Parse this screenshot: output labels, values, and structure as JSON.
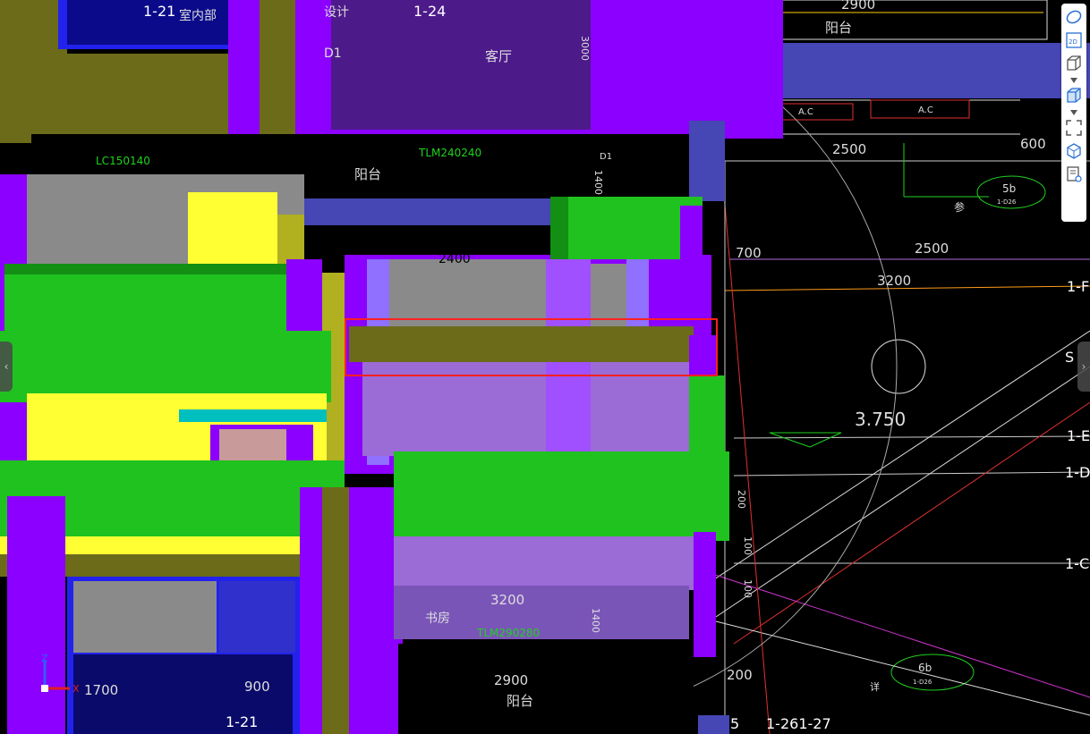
{
  "toolbar": {
    "icons": [
      "orbit-icon",
      "2d-view-icon",
      "3d-box-icon",
      "shaded-box-icon",
      "fullscreen-icon",
      "view-cube-icon",
      "properties-icon"
    ],
    "label_2d": "2D"
  },
  "nav": {
    "left_arrow": "‹",
    "right_arrow": "›"
  },
  "cad": {
    "room_labels": {
      "indoor": "室内部",
      "design": "设计",
      "living": "客厅",
      "balcony_top_right": "阳台",
      "balcony_mid": "阳台",
      "study": "书房",
      "balcony_bottom": "阳台"
    },
    "grid_labels": {
      "g121_top": "1-21",
      "g124": "1-24",
      "g1F": "1-F",
      "g1E": "1-E",
      "g1D": "1-D",
      "g1C": "1-C",
      "gS": "S",
      "g121_bottom": "1-21",
      "g126": "1-261-27",
      "g5": "5"
    },
    "window_labels": {
      "lc": "LC150140",
      "tlm1": "TLM240240",
      "tlm2": "TLM290280",
      "d1": "D1",
      "d1b": "D1",
      "ac1": "A.C",
      "ac2": "A.C"
    },
    "dims": {
      "d2900_top": "2900",
      "d2500_a": "2500",
      "d600": "600",
      "d700": "700",
      "d2500_b": "2500",
      "d3200": "3200",
      "d2400": "2400",
      "elev": "3.750",
      "d3200_b": "3200",
      "d2900_b": "2900",
      "d1700": "1700",
      "d900": "900",
      "d200": "200",
      "v1400_a": "1400",
      "v1400_b": "1400",
      "v100": "100",
      "v200": "200",
      "v3000": "3000",
      "v100b": "100"
    },
    "tags": {
      "tag5b": "5b",
      "tag5b_sub": "1-D26",
      "tag6b": "6b",
      "tag6b_sub": "1-D26",
      "ref1": "参",
      "ref2": "详"
    }
  },
  "axis": {
    "z": "Z",
    "x": "X"
  },
  "colors": {
    "purple": "#8B00FF",
    "green": "#1FC21F",
    "yellow": "#FFFF33",
    "olive": "#6B6B1A",
    "gray": "#8A8A8A",
    "blue": "#2222EE",
    "light_purple": "#9B6BD6",
    "selection": "#FF2020"
  }
}
